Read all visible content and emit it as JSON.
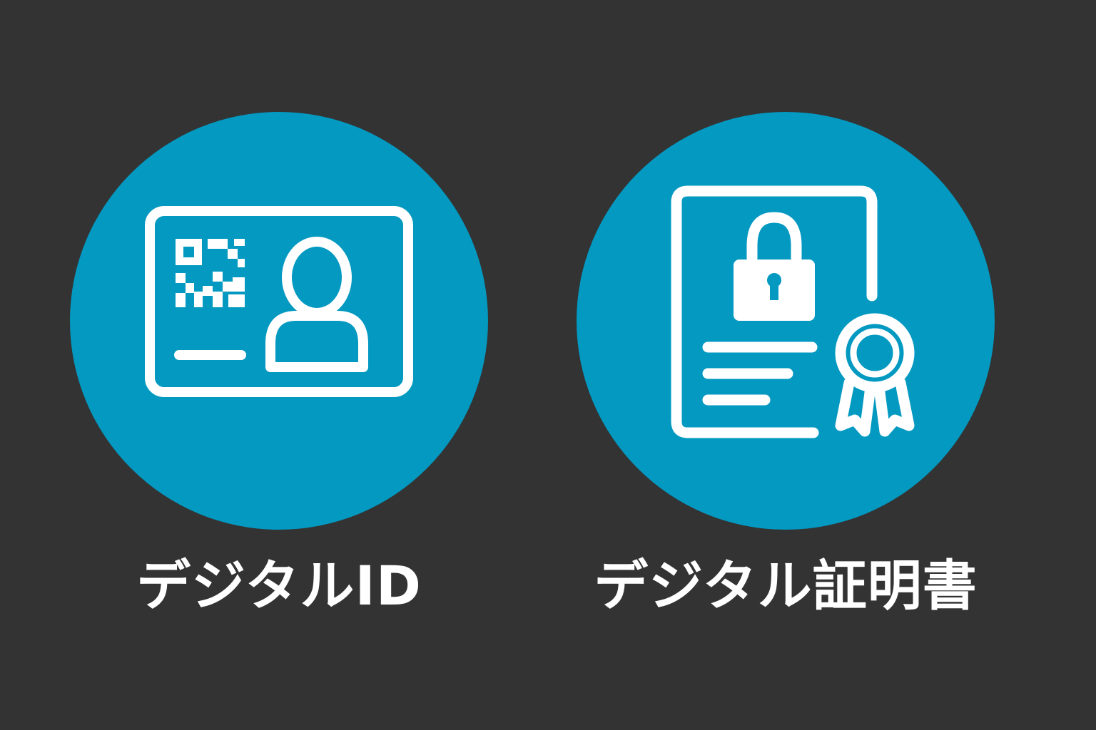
{
  "colors": {
    "background": "#333333",
    "circle": "#0399c1",
    "icon_stroke": "#ffffff",
    "label_text": "#ffffff"
  },
  "items": [
    {
      "icon": "id-card-icon",
      "label": "デジタルID"
    },
    {
      "icon": "certificate-icon",
      "label": "デジタル証明書"
    }
  ]
}
